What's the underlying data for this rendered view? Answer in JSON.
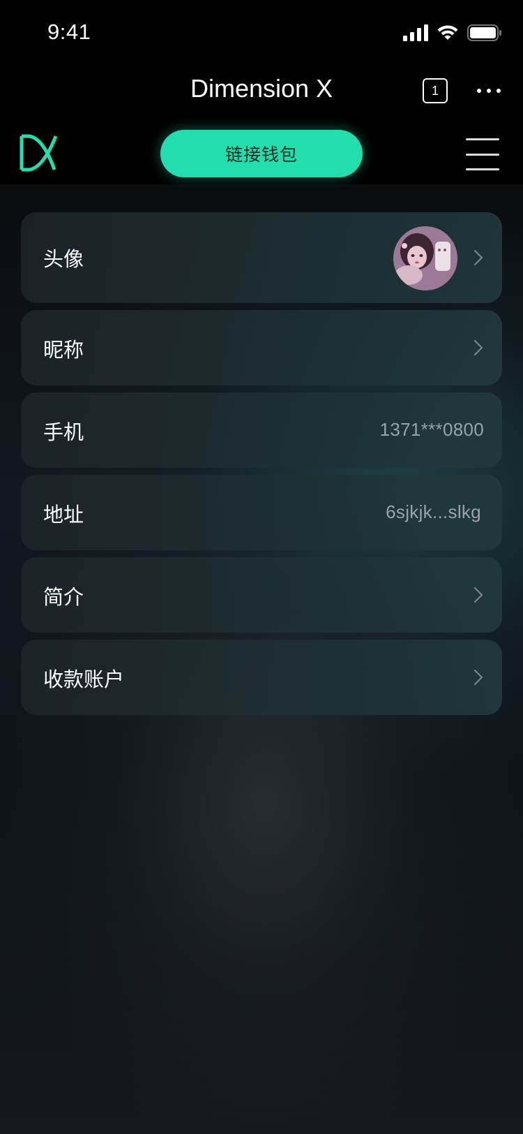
{
  "status_bar": {
    "time": "9:41",
    "icons": [
      "cellular-signal-icon",
      "wifi-icon",
      "battery-icon"
    ]
  },
  "nav": {
    "title": "Dimension X",
    "tab_count": "1",
    "more_icon": "more-dots-icon"
  },
  "header": {
    "logo_icon": "dimension-x-logo",
    "connect_wallet_label": "链接钱包",
    "menu_icon": "hamburger-menu-icon"
  },
  "profile": {
    "rows": [
      {
        "label": "头像",
        "value": "",
        "has_chevron": true,
        "has_avatar": true
      },
      {
        "label": "昵称",
        "value": "",
        "has_chevron": true
      },
      {
        "label": "手机",
        "value": "1371***0800",
        "has_chevron": false
      },
      {
        "label": "地址",
        "value": "6sjkjk...slkg",
        "has_chevron": false
      },
      {
        "label": "简介",
        "value": "",
        "has_chevron": true
      },
      {
        "label": "收款账户",
        "value": "",
        "has_chevron": true
      }
    ]
  },
  "colors": {
    "accent": "#22ddae",
    "background": "#000000",
    "row_background": "#1e2e32",
    "secondary_text": "#9aa3a8"
  }
}
